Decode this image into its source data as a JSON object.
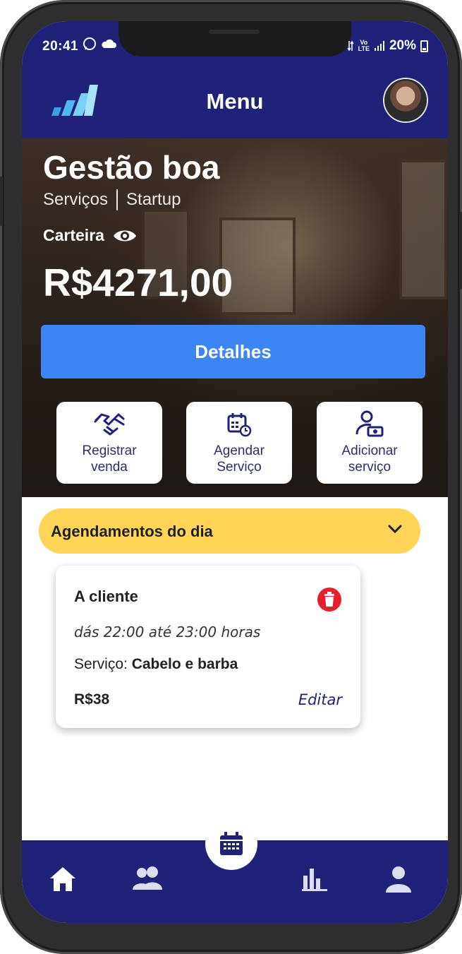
{
  "status": {
    "time": "20:41",
    "battery": "20%",
    "network": "LTE"
  },
  "header": {
    "title": "Menu"
  },
  "business": {
    "name": "Gestão boa",
    "category": "Serviços",
    "stage": "Startup"
  },
  "wallet": {
    "label": "Carteira",
    "value": "R$4271,00",
    "details_label": "Detalhes"
  },
  "actions": [
    {
      "line1": "Registrar",
      "line2": "venda",
      "icon": "handshake-icon"
    },
    {
      "line1": "Agendar",
      "line2": "Serviço",
      "icon": "calendar-clock-icon"
    },
    {
      "line1": "Adicionar",
      "line2": "serviço",
      "icon": "user-cash-icon"
    }
  ],
  "agenda": {
    "title": "Agendamentos do dia",
    "appointments": [
      {
        "client": "A cliente",
        "time": "dás 22:00 até 23:00 horas",
        "service_label": "Serviço:",
        "service": "Cabelo e barba",
        "price": "R$38",
        "edit_label": "Editar"
      }
    ]
  },
  "nav": {
    "items": [
      "home-icon",
      "users-icon",
      "calendar-icon",
      "chart-icon",
      "profile-icon"
    ]
  },
  "colors": {
    "primary": "#1f2278",
    "accent_blue": "#3d84f5",
    "agenda_yellow": "#ffd457",
    "danger": "#e3202a"
  }
}
